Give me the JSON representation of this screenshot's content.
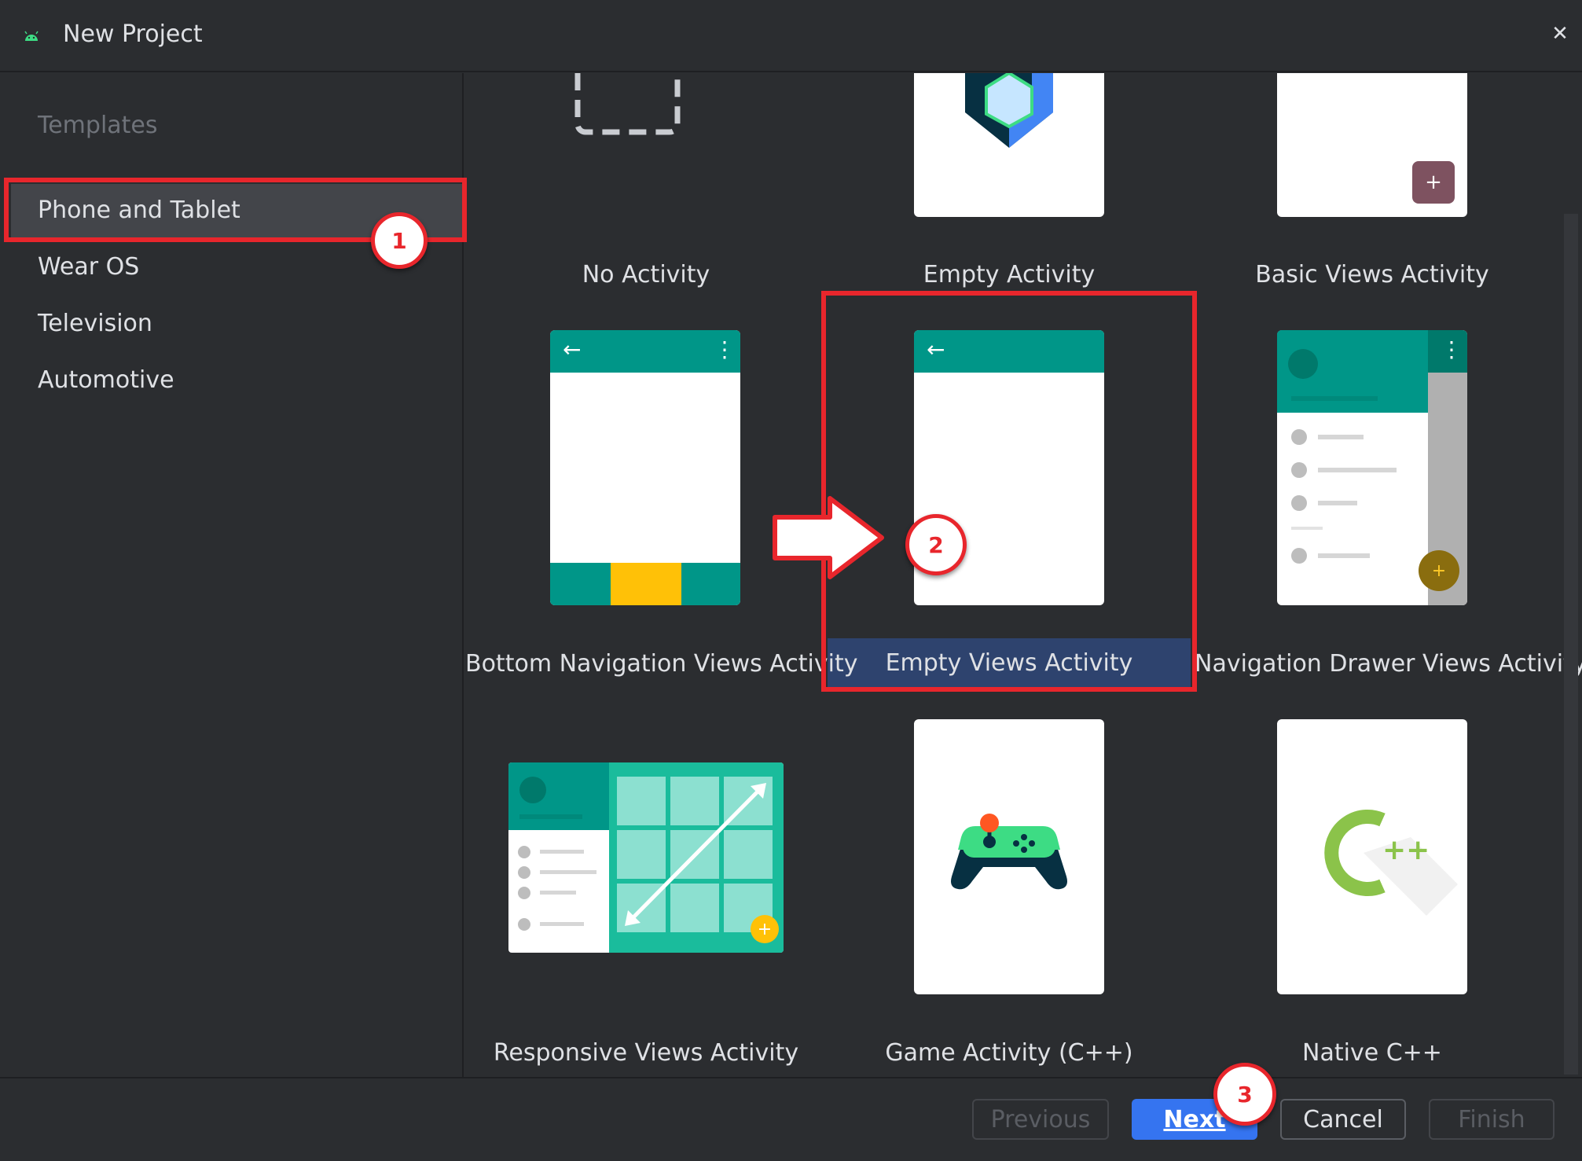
{
  "window": {
    "title": "New Project",
    "close_glyph": "✕"
  },
  "sidebar": {
    "heading": "Templates",
    "items": [
      {
        "label": "Phone and Tablet",
        "selected": true
      },
      {
        "label": "Wear OS"
      },
      {
        "label": "Television"
      },
      {
        "label": "Automotive"
      }
    ]
  },
  "templates": [
    {
      "label": "No Activity"
    },
    {
      "label": "Empty Activity"
    },
    {
      "label": "Basic Views Activity"
    },
    {
      "label": "Bottom Navigation Views Activity"
    },
    {
      "label": "Empty Views Activity",
      "selected": true
    },
    {
      "label": "Navigation Drawer Views Activity"
    },
    {
      "label": "Responsive Views Activity"
    },
    {
      "label": "Game Activity (C++)"
    },
    {
      "label": "Native C++"
    }
  ],
  "preview_glyphs": {
    "back_arrow": "←",
    "overflow_menu": "⋮",
    "fab_plus": "+",
    "cpp_plus": "++"
  },
  "buttons": {
    "previous": "Previous",
    "next": "Next",
    "cancel": "Cancel",
    "finish": "Finish"
  },
  "annotations": [
    "1",
    "2",
    "3"
  ],
  "colors": {
    "accent": "#3574f0",
    "selection": "#2e436e",
    "teal": "#009688",
    "annotation_red": "#e8262c",
    "amber": "#ffc107"
  }
}
